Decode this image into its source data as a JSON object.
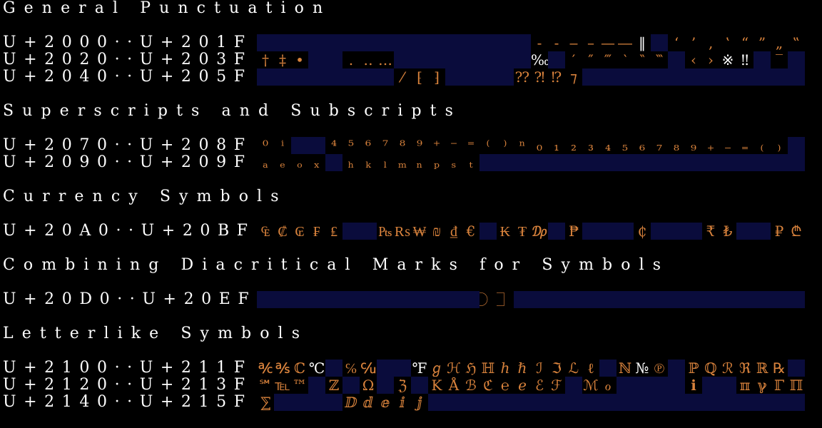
{
  "colors": {
    "background": "#000000",
    "empty_cell": "#0a0c3c",
    "glyph": "#d8823c",
    "label": "#ffffff"
  },
  "sections": [
    {
      "title": "General Punctuation",
      "rows": [
        {
          "label": "U+2000··U+201F",
          "cells": [
            "",
            "",
            "",
            "",
            "",
            "",
            "",
            "",
            "",
            "",
            "",
            "",
            "",
            "",
            "",
            "",
            "‐",
            "‑",
            "‒",
            "–",
            "—",
            "―",
            "‖",
            "",
            "‘",
            "’",
            "‚",
            "‛",
            "“",
            "”",
            "„",
            "‟"
          ]
        },
        {
          "label": "U+2020··U+203F",
          "cells": [
            "†",
            "‡",
            "•",
            "",
            "",
            "․",
            "‥",
            "…",
            "",
            "",
            "",
            "",
            "",
            "",
            "",
            "",
            "‰",
            "",
            "′",
            "″",
            "‴",
            "‵",
            "‶",
            "‷",
            "",
            "‹",
            "›",
            "※",
            "‼",
            "",
            "‾",
            ""
          ]
        },
        {
          "label": "U+2040··U+205F",
          "cells": [
            "",
            "",
            "",
            "",
            "",
            "",
            "",
            "",
            "⁄",
            "⁅",
            "⁆",
            "",
            "",
            "",
            "",
            "⁇",
            "⁈",
            "⁉",
            "⁊",
            "",
            "",
            "",
            "",
            "",
            "",
            "",
            "",
            "",
            "",
            "",
            "",
            ""
          ]
        }
      ]
    },
    {
      "title": "Superscripts and Subscripts",
      "rows": [
        {
          "label": "U+2070··U+208F",
          "cells": [
            "⁰",
            "ⁱ",
            "",
            "",
            "⁴",
            "⁵",
            "⁶",
            "⁷",
            "⁸",
            "⁹",
            "⁺",
            "⁻",
            "⁼",
            "⁽",
            "⁾",
            "ⁿ",
            "₀",
            "₁",
            "₂",
            "₃",
            "₄",
            "₅",
            "₆",
            "₇",
            "₈",
            "₉",
            "₊",
            "₋",
            "₌",
            "₍",
            "₎",
            ""
          ]
        },
        {
          "label": "U+2090··U+209F",
          "cells": [
            "ₐ",
            "ₑ",
            "ₒ",
            "ₓ",
            "",
            "ₕ",
            "ₖ",
            "ₗ",
            "ₘ",
            "ₙ",
            "ₚ",
            "ₛ",
            "ₜ",
            "",
            "",
            "",
            "",
            "",
            "",
            "",
            "",
            "",
            "",
            "",
            "",
            "",
            "",
            "",
            "",
            "",
            "",
            ""
          ]
        }
      ]
    },
    {
      "title": "Currency Symbols",
      "rows": [
        {
          "label": "U+20A0··U+20BF",
          "cells": [
            "₠",
            "₡",
            "₢",
            "₣",
            "₤",
            "",
            "",
            "₧",
            "₨",
            "₩",
            "₪",
            "₫",
            "€",
            "",
            "₭",
            "₮",
            "₯",
            "",
            "₱",
            "",
            "",
            "",
            "₵",
            "",
            "",
            "",
            "₹",
            "₺",
            "",
            "",
            "₽",
            "₾"
          ]
        }
      ]
    },
    {
      "title": "Combining Diacritical Marks for Symbols",
      "rows": [
        {
          "label": "U+20D0··U+20EF",
          "cells": [
            "",
            "",
            "",
            "",
            "",
            "",
            "",
            "",
            "",
            "",
            "",
            "",
            "",
            "⃝",
            "⃞",
            "",
            "",
            "",
            "",
            "",
            "",
            "",
            "",
            "",
            "",
            "",
            "",
            "",
            "",
            "",
            "",
            ""
          ]
        }
      ]
    },
    {
      "title": "Letterlike Symbols",
      "rows": [
        {
          "label": "U+2100··U+211F",
          "cells": [
            "℀",
            "℁",
            "ℂ",
            "℃",
            "",
            "℅",
            "℆",
            "",
            "",
            "℉",
            "ℊ",
            "ℋ",
            "ℌ",
            "ℍ",
            "ℎ",
            "ℏ",
            "ℐ",
            "ℑ",
            "ℒ",
            "ℓ",
            "",
            "ℕ",
            "№",
            "℗",
            "",
            "ℙ",
            "ℚ",
            "ℛ",
            "ℜ",
            "ℝ",
            "℞",
            ""
          ]
        },
        {
          "label": "U+2120··U+213F",
          "cells": [
            "℠",
            "℡",
            "™",
            "",
            "ℤ",
            "",
            "Ω",
            "",
            "ℨ",
            "",
            "K",
            "Å",
            "ℬ",
            "ℭ",
            "℮",
            "ℯ",
            "ℰ",
            "ℱ",
            "",
            "ℳ",
            "ℴ",
            "",
            "",
            "",
            "",
            "ℹ",
            "",
            "",
            "ℼ",
            "ℽ",
            "ℾ",
            "ℿ"
          ]
        },
        {
          "label": "U+2140··U+215F",
          "cells": [
            "⅀",
            "",
            "",
            "",
            "",
            "ⅅ",
            "ⅆ",
            "ⅇ",
            "ⅈ",
            "ⅉ",
            "",
            "",
            "",
            "",
            "",
            "",
            "",
            "",
            "",
            "",
            "",
            "",
            "",
            "",
            "",
            "",
            "",
            "",
            "",
            "",
            "",
            ""
          ]
        }
      ]
    }
  ]
}
